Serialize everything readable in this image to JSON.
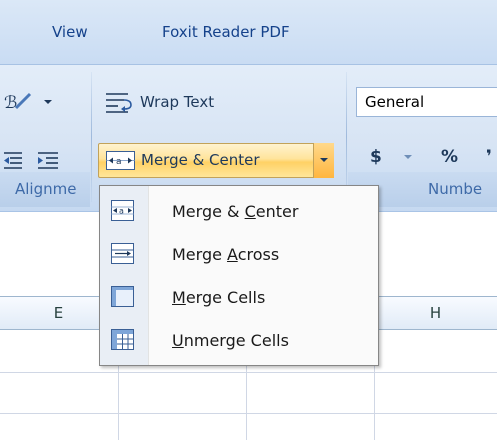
{
  "tabs": [
    {
      "label": "View"
    },
    {
      "label": "Foxit Reader PDF"
    }
  ],
  "ribbon": {
    "wrap_text_label": "Wrap Text",
    "merge_center_label": "Merge & Center",
    "number_format_value": "General",
    "currency_symbol": "$",
    "percent_symbol": "%",
    "groups": {
      "alignment_label": "Alignme",
      "number_label": "Numbe"
    }
  },
  "columns": [
    "E",
    "H"
  ],
  "menu": {
    "items": [
      {
        "pre": "Merge & ",
        "ul": "C",
        "post": "enter",
        "icon": "merge-center-icon"
      },
      {
        "pre": "Merge ",
        "ul": "A",
        "post": "cross",
        "icon": "merge-across-icon"
      },
      {
        "pre": "",
        "ul": "M",
        "post": "erge Cells",
        "icon": "merge-cells-icon"
      },
      {
        "pre": "",
        "ul": "U",
        "post": "nmerge Cells",
        "icon": "unmerge-cells-icon"
      }
    ]
  },
  "colors": {
    "highlight_top": "#fff3cf",
    "highlight_bottom": "#ffd165",
    "ribbon_bg": "#d7e4f4",
    "text": "#1e395b"
  }
}
